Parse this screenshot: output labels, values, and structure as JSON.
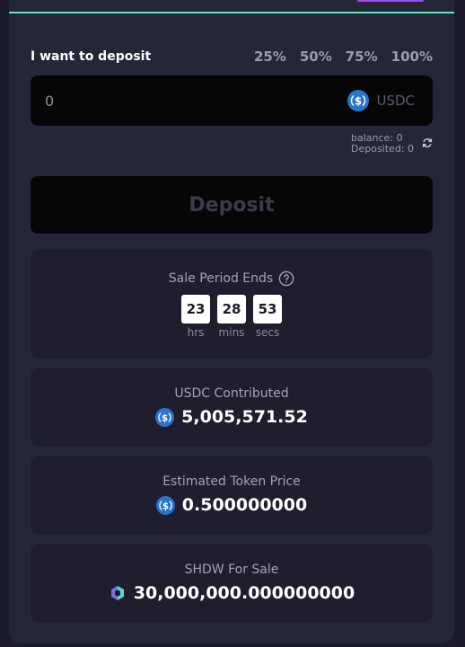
{
  "deposit": {
    "label": "I want to deposit",
    "percent_options": [
      "25%",
      "50%",
      "75%",
      "100%"
    ],
    "amount_placeholder": "0",
    "token": "USDC",
    "balance": "balance: 0",
    "deposited": "Deposited: 0",
    "button_label": "Deposit"
  },
  "sale_period": {
    "title": "Sale Period Ends",
    "hours": "23",
    "hours_label": "hrs",
    "minutes": "28",
    "minutes_label": "mins",
    "seconds": "53",
    "seconds_label": "secs"
  },
  "stats": {
    "usdc_contributed_label": "USDC Contributed",
    "usdc_contributed_value": "5,005,571.52",
    "token_price_label": "Estimated Token Price",
    "token_price_value": "0.500000000",
    "for_sale_label": "SHDW For Sale",
    "for_sale_value": "30,000,000.000000000"
  },
  "colors": {
    "accent_line": "#5ee6c4",
    "chip": "#a047f5",
    "usdc_blue": "#2775ca",
    "panel": "#262639",
    "card": "#1e1e2f"
  },
  "icons": [
    "usdc-icon",
    "refresh-icon",
    "help-circle-icon",
    "shdw-icon"
  ]
}
